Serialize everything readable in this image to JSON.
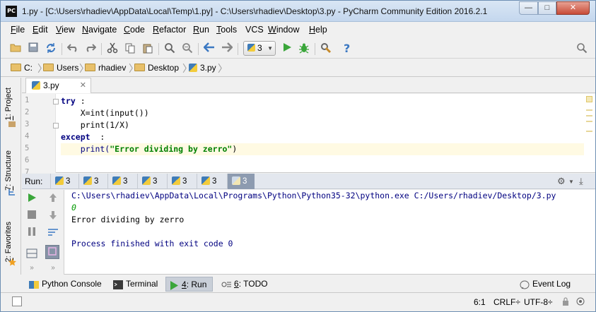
{
  "window": {
    "logo": "PC",
    "title": "1.py - [C:\\Users\\rhadiev\\AppData\\Local\\Temp\\1.py] - C:\\Users\\rhadiev\\Desktop\\3.py - PyCharm Community Edition 2016.2.1",
    "min_label": "—",
    "max_label": "□",
    "close_label": "✕"
  },
  "menu": [
    {
      "mnemonic": "F",
      "rest": "ile"
    },
    {
      "mnemonic": "E",
      "rest": "dit"
    },
    {
      "mnemonic": "V",
      "rest": "iew"
    },
    {
      "mnemonic": "N",
      "rest": "avigate"
    },
    {
      "mnemonic": "C",
      "rest": "ode"
    },
    {
      "mnemonic": "R",
      "rest": "efactor"
    },
    {
      "mnemonic": "R",
      "rest": "un"
    },
    {
      "mnemonic": "T",
      "rest": "ools"
    },
    {
      "mnemonic": "",
      "rest": "VCS"
    },
    {
      "mnemonic": "W",
      "rest": "indow"
    },
    {
      "mnemonic": "H",
      "rest": "elp"
    }
  ],
  "toolbar": {
    "run_config_label": "3",
    "icons": [
      "open-folder-icon",
      "save-icon",
      "sync-icon",
      "undo-icon",
      "redo-icon",
      "cut-icon",
      "copy-icon",
      "paste-icon",
      "find-icon",
      "replace-icon",
      "back-icon",
      "forward-icon",
      "run-icon",
      "debug-icon",
      "settings-icon",
      "help-icon",
      "search-everywhere-icon"
    ]
  },
  "breadcrumb": [
    "C:",
    "Users",
    "rhadiev",
    "Desktop",
    "3.py"
  ],
  "side_tabs": {
    "project": {
      "num": "1",
      "label": ": Project"
    },
    "structure": {
      "num": "7",
      "label": ": Structure"
    },
    "favorites": {
      "num": "2",
      "label": ": Favorites"
    }
  },
  "editor": {
    "tab_label": "3.py",
    "close_glyph": "✕",
    "line_numbers": [
      "1",
      "2",
      "3",
      "4",
      "5",
      "6",
      "7"
    ],
    "lines": {
      "l1_kw": "try",
      "l1_rest": " :",
      "l2": "    X=int(input())",
      "l3": "    print(1/X)",
      "l4_kw": "except",
      "l4_rest": "  :",
      "l5_fn": "    print(",
      "l5_str": "\"Error dividing by zerro\"",
      "l5_end": ")"
    }
  },
  "run": {
    "label": "Run:",
    "tabs": [
      "3",
      "3",
      "3",
      "3",
      "3",
      "3",
      "3"
    ],
    "active_tab_index": 6,
    "console": {
      "cmd": "C:\\Users\\rhadiev\\AppData\\Local\\Programs\\Python\\Python35-32\\python.exe C:/Users/rhadiev/Desktop/3.py",
      "input": "0",
      "output": "Error dividing by zerro",
      "exit": "Process finished with exit code 0"
    }
  },
  "tool_tabs": {
    "python_console": "Python Console",
    "terminal": "Terminal",
    "run_num": "4",
    "run_label": ": Run",
    "todo_num": "6",
    "todo_label": ": TODO",
    "event_log": "Event Log"
  },
  "status": {
    "position": "6:1",
    "line_sep": "CRLF÷",
    "encoding": "UTF-8÷"
  },
  "colors": {
    "keyword": "#000080",
    "string": "#008000",
    "current_line": "#fffae3",
    "run_green": "#3aa63a"
  }
}
